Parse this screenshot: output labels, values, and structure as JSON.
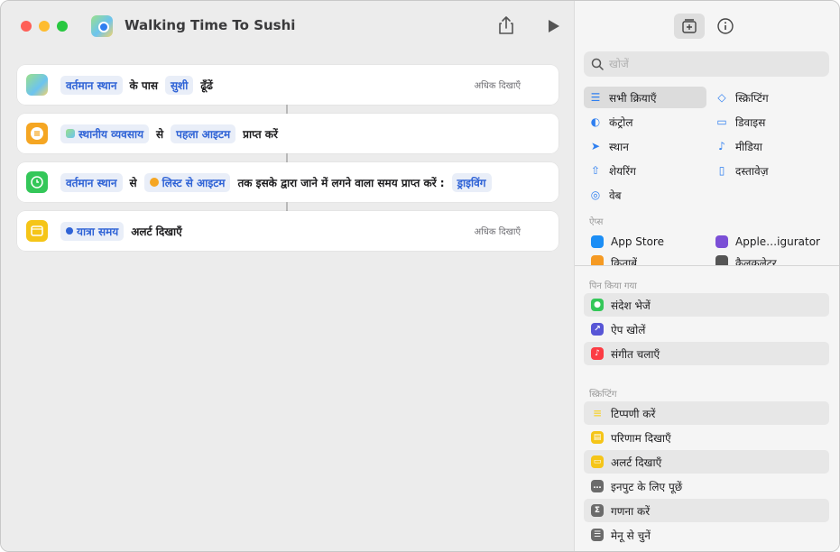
{
  "window": {
    "title": "Walking Time To Sushi"
  },
  "actions": [
    {
      "tokens": [
        "वर्तमान स्थान",
        "सुशी"
      ],
      "texts": [
        "के पास",
        "ढूँढें"
      ],
      "more": "अधिक दिखाएँ"
    },
    {
      "tokens": [
        "स्थानीय व्यवसाय",
        "पहला आइटम"
      ],
      "texts": [
        "से",
        "प्राप्त करें"
      ]
    },
    {
      "tokens": [
        "वर्तमान स्थान",
        "लिस्ट से आइटम",
        "ड्राइविंग"
      ],
      "texts": [
        "से",
        "तक इसके द्वारा जाने में लगने वाला समय प्राप्त करें :"
      ]
    },
    {
      "tokens": [
        "यात्रा समय"
      ],
      "texts": [
        "अलर्ट दिखाएँ"
      ],
      "more": "अधिक दिखाएँ"
    }
  ],
  "sidebar": {
    "search_placeholder": "खोजें",
    "categories": [
      {
        "label": "सभी क्रियाएँ",
        "icon": "list-icon"
      },
      {
        "label": "स्क्रिप्टिंग",
        "icon": "scripting-icon"
      },
      {
        "label": "कंट्रोल",
        "icon": "toggle-icon"
      },
      {
        "label": "डिवाइस",
        "icon": "monitor-icon"
      },
      {
        "label": "स्थान",
        "icon": "location-arrow-icon"
      },
      {
        "label": "मीडिया",
        "icon": "music-note-icon"
      },
      {
        "label": "शेयरिंग",
        "icon": "share-icon"
      },
      {
        "label": "दस्तावेज़",
        "icon": "document-icon"
      },
      {
        "label": "वेब",
        "icon": "compass-icon"
      }
    ],
    "apps_label": "ऐप्स",
    "apps": [
      {
        "label": "App Store",
        "color": "#1c8ef5"
      },
      {
        "label": "Apple…igurator",
        "color": "#7b4fd6"
      },
      {
        "label": "किताबें",
        "color": "#f59a23"
      },
      {
        "label": "कैलकुलेटर",
        "color": "#555555"
      }
    ],
    "pinned_label": "पिन किया गया",
    "pinned": [
      {
        "label": "संदेश भेजें",
        "color": "#34c759",
        "icon": "message-icon"
      },
      {
        "label": "ऐप खोलें",
        "color": "#5856d6",
        "icon": "open-app-icon"
      },
      {
        "label": "संगीत चलाएँ",
        "color": "#fc3c44",
        "icon": "music-icon"
      }
    ],
    "scripting_label": "स्क्रिप्टिंग",
    "scripting": [
      {
        "label": "टिप्पणी करें",
        "color": "#f5d443",
        "icon": "comment-icon"
      },
      {
        "label": "परिणाम दिखाएँ",
        "color": "#f5c518",
        "icon": "result-icon"
      },
      {
        "label": "अलर्ट दिखाएँ",
        "color": "#f5c518",
        "icon": "alert-icon"
      },
      {
        "label": "इनपुट के लिए पूछें",
        "color": "#6b6b6b",
        "icon": "input-icon"
      },
      {
        "label": "गणना करें",
        "color": "#6b6b6b",
        "icon": "sigma-icon"
      },
      {
        "label": "मेनू से चुनें",
        "color": "#6b6b6b",
        "icon": "menu-icon"
      }
    ]
  }
}
